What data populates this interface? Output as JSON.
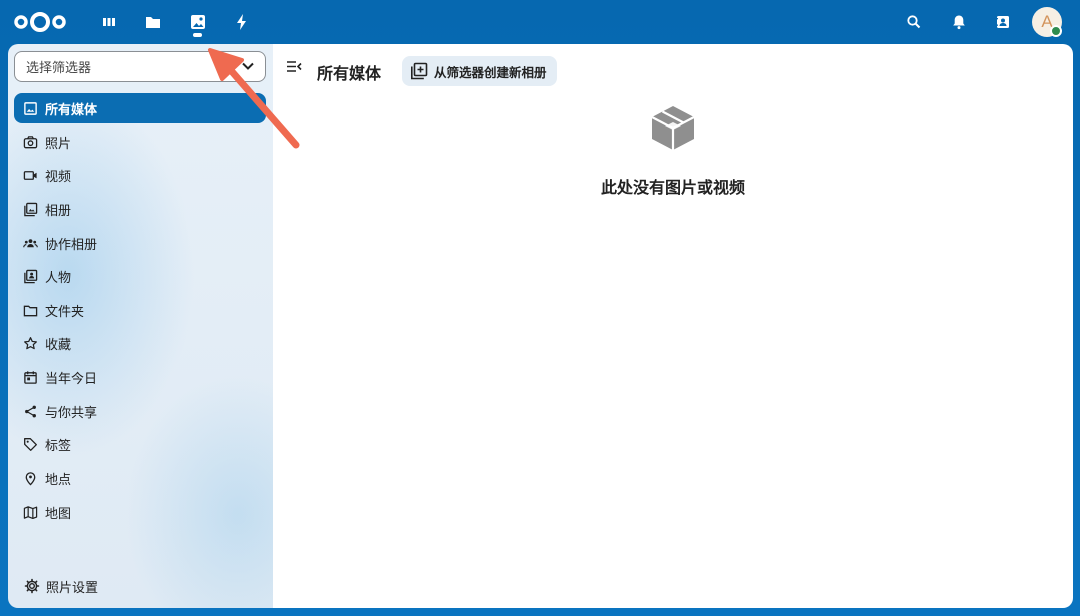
{
  "header": {
    "apps": [
      {
        "name": "dashboard-icon",
        "active": false
      },
      {
        "name": "files-icon",
        "active": false
      },
      {
        "name": "photos-icon",
        "active": true
      },
      {
        "name": "activity-icon",
        "active": false
      }
    ],
    "right_icons": [
      "search-icon",
      "bell-icon",
      "contacts-icon"
    ],
    "avatar_letter": "A"
  },
  "sidebar": {
    "filter_placeholder": "选择筛选器",
    "items": [
      {
        "label": "所有媒体",
        "icon": "image-icon",
        "active": true
      },
      {
        "label": "照片",
        "icon": "camera-icon"
      },
      {
        "label": "视频",
        "icon": "video-icon"
      },
      {
        "label": "相册",
        "icon": "album-icon"
      },
      {
        "label": "协作相册",
        "icon": "group-icon"
      },
      {
        "label": "人物",
        "icon": "person-icon"
      },
      {
        "label": "文件夹",
        "icon": "folder-icon"
      },
      {
        "label": "收藏",
        "icon": "star-icon"
      },
      {
        "label": "当年今日",
        "icon": "calendar-icon"
      },
      {
        "label": "与你共享",
        "icon": "share-icon"
      },
      {
        "label": "标签",
        "icon": "tag-icon"
      },
      {
        "label": "地点",
        "icon": "location-icon"
      },
      {
        "label": "地图",
        "icon": "map-icon"
      }
    ],
    "settings_label": "照片设置"
  },
  "main": {
    "title": "所有媒体",
    "create_button": "从筛选器创建新相册",
    "empty_text": "此处没有图片或视频"
  },
  "colors": {
    "header_bg": "#0668b0",
    "active_item": "#0b6db2",
    "annotation_arrow": "#ef6a50"
  }
}
